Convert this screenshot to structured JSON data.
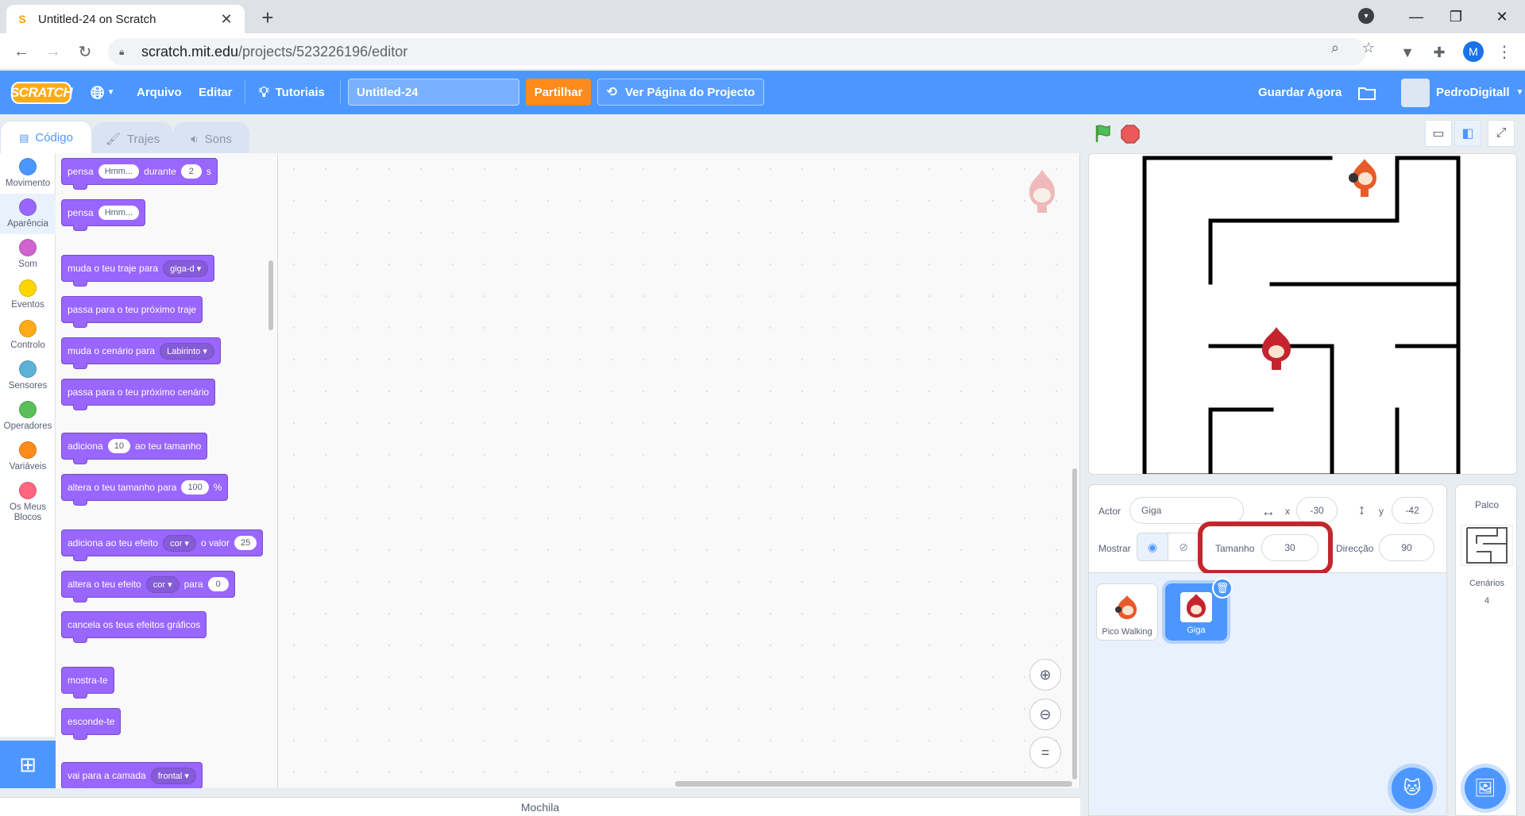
{
  "browser": {
    "tab_title": "Untitled-24 on Scratch",
    "url_host": "scratch.mit.edu",
    "url_path": "/projects/523226196/editor",
    "profile_initial": "M"
  },
  "menubar": {
    "logo": "SCRATCH",
    "file": "Arquivo",
    "edit": "Editar",
    "tutorials": "Tutoriais",
    "project_title": "Untitled-24",
    "share": "Partilhar",
    "see_project": "Ver Página do Projecto",
    "save_now": "Guardar Agora",
    "username": "PedroDigitall"
  },
  "editor_tabs": {
    "code": "Código",
    "costumes": "Trajes",
    "sounds": "Sons"
  },
  "categories": [
    {
      "label": "Movimento",
      "color": "#4c97ff"
    },
    {
      "label": "Aparência",
      "color": "#9966ff"
    },
    {
      "label": "Som",
      "color": "#cf63cf"
    },
    {
      "label": "Eventos",
      "color": "#ffd500"
    },
    {
      "label": "Controlo",
      "color": "#ffab19"
    },
    {
      "label": "Sensores",
      "color": "#5cb1d6"
    },
    {
      "label": "Operadores",
      "color": "#59c059"
    },
    {
      "label": "Variáveis",
      "color": "#ff8c1a"
    },
    {
      "label": "Os Meus Blocos",
      "color": "#ff6680"
    }
  ],
  "blocks": {
    "b1": {
      "t1": "pensa",
      "v1": "Hmm...",
      "t2": "durante",
      "v2": "2",
      "t3": "s"
    },
    "b2": {
      "t1": "pensa",
      "v1": "Hmm..."
    },
    "b3": {
      "t1": "muda o teu traje para",
      "d1": "giga-d"
    },
    "b4": {
      "t1": "passa para o teu próximo traje"
    },
    "b5": {
      "t1": "muda o cenário para",
      "d1": "Labirinto"
    },
    "b6": {
      "t1": "passa para o teu próximo cenário"
    },
    "b7": {
      "t1": "adiciona",
      "v1": "10",
      "t2": "ao teu tamanho"
    },
    "b8": {
      "t1": "altera o teu tamanho para",
      "v1": "100",
      "t2": "%"
    },
    "b9": {
      "t1": "adiciona ao teu efeito",
      "d1": "cor",
      "t2": "o valor",
      "v1": "25"
    },
    "b10": {
      "t1": "altera o teu efeito",
      "d1": "cor",
      "t2": "para",
      "v1": "0"
    },
    "b11": {
      "t1": "cancela os teus efeitos gráficos"
    },
    "b12": {
      "t1": "mostra-te"
    },
    "b13": {
      "t1": "esconde-te"
    },
    "b14": {
      "t1": "vai para a camada",
      "d1": "frontal"
    }
  },
  "backpack": "Mochila",
  "sprite_info": {
    "actor_label": "Actor",
    "actor_name": "Giga",
    "x_label": "x",
    "x_value": "-30",
    "y_label": "y",
    "y_value": "-42",
    "show_label": "Mostrar",
    "size_label": "Tamanho",
    "size_value": "30",
    "direction_label": "Direcção",
    "direction_value": "90"
  },
  "sprites": [
    {
      "name": "Pico Walking"
    },
    {
      "name": "Giga"
    }
  ],
  "stage_panel": {
    "title": "Palco",
    "backdrops_label": "Cenários",
    "backdrops_count": "4"
  }
}
